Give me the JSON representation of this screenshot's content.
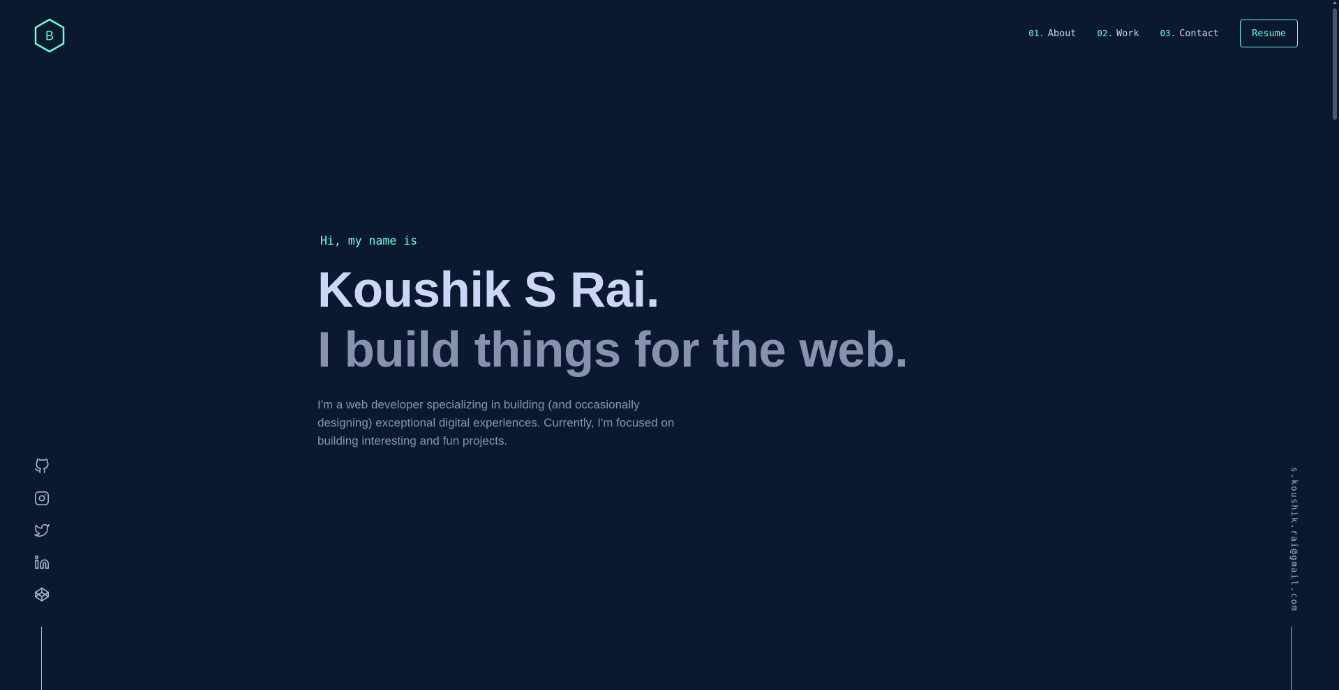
{
  "header": {
    "logo_letter": "B",
    "nav": [
      {
        "num": "01.",
        "label": "About"
      },
      {
        "num": "02.",
        "label": "Work"
      },
      {
        "num": "03.",
        "label": "Contact"
      }
    ],
    "resume_label": "Resume"
  },
  "hero": {
    "greeting": "Hi, my name is",
    "name": "Koushik S Rai.",
    "tagline": "I build things for the web.",
    "description": "I'm a web developer specializing in building (and occasionally designing) exceptional digital experiences. Currently, I'm focused on building interesting and fun projects."
  },
  "social": {
    "icons": [
      "github-icon",
      "instagram-icon",
      "twitter-icon",
      "linkedin-icon",
      "codepen-icon"
    ]
  },
  "contact": {
    "email": "s.koushik.rai@gmail.com"
  },
  "colors": {
    "background": "#0a192f",
    "accent": "#64ffda",
    "heading": "#ccd6f6",
    "text": "#8892b0"
  }
}
